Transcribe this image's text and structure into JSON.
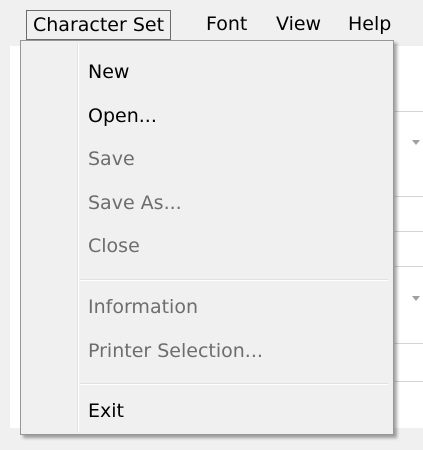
{
  "menubar": {
    "items": [
      {
        "label": "Character Set"
      },
      {
        "label": "Font"
      },
      {
        "label": "View"
      },
      {
        "label": "Help"
      }
    ]
  },
  "menu": {
    "items": [
      {
        "label": "New",
        "enabled": true
      },
      {
        "label": "Open...",
        "enabled": true
      },
      {
        "label": "Save",
        "enabled": false
      },
      {
        "label": "Save As...",
        "enabled": false
      },
      {
        "label": "Close",
        "enabled": false
      },
      {
        "label": "Information",
        "enabled": false
      },
      {
        "label": "Printer Selection...",
        "enabled": false
      },
      {
        "label": "Exit",
        "enabled": true
      }
    ]
  },
  "background": {
    "icons": [
      "dropdown-arrow-icon",
      "dropdown-arrow-icon"
    ]
  }
}
